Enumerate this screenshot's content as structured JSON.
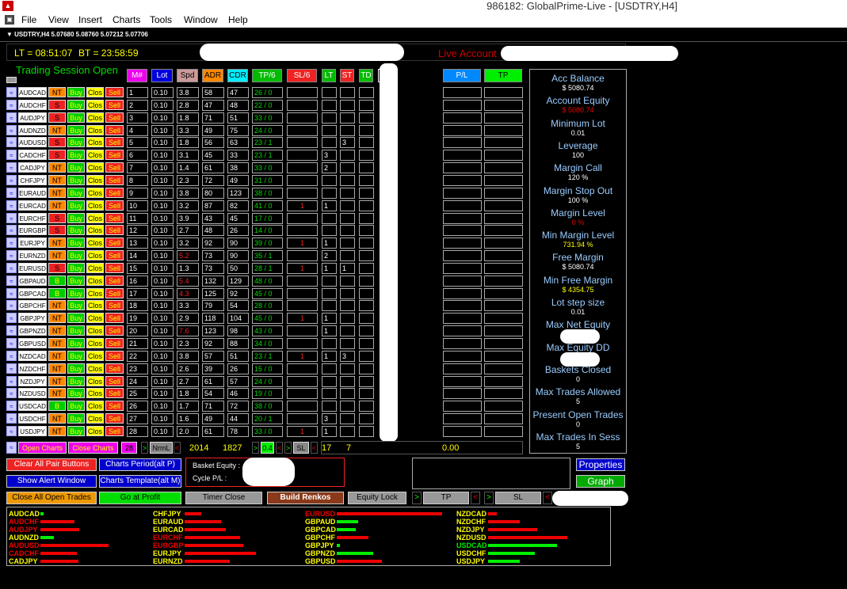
{
  "window": {
    "title": "986182: GlobalPrime-Live - [USDTRY,H4]"
  },
  "menu": [
    "File",
    "View",
    "Insert",
    "Charts",
    "Tools",
    "Window",
    "Help"
  ],
  "chart": {
    "symbol_line": "USDTRY,H4  5.07680 5.08760 5.07212 5.07706"
  },
  "header": {
    "lt": "LT = 08:51:07",
    "bt": "BT = 23:58:59",
    "live": "Live Account"
  },
  "session": "Trading Session Open",
  "columns": {
    "num": "M#",
    "lot": "Lot",
    "spd": "Spd",
    "adr": "ADR",
    "cdr": "CDR",
    "tp": "TP/6",
    "sl": "SL/6",
    "lt": "LT",
    "st": "ST",
    "td": "TD",
    "pl": "P/L",
    "tpr": "TP"
  },
  "row_buttons": {
    "buy": "Buy",
    "close": "Clos",
    "sell": "Sell"
  },
  "rows": [
    {
      "pair": "AUDCAD",
      "mode": "NT",
      "n": "1",
      "lot": "0.10",
      "spd": "3.8",
      "adr": "58",
      "cdr": "47",
      "tp": "26 / 0",
      "sl": "",
      "lt": "",
      "st": "",
      "spd_red": false
    },
    {
      "pair": "AUDCHF",
      "mode": "S",
      "n": "2",
      "lot": "0.10",
      "spd": "2.8",
      "adr": "47",
      "cdr": "48",
      "tp": "22 / 0",
      "sl": "",
      "lt": "",
      "st": "",
      "spd_red": false
    },
    {
      "pair": "AUDJPY",
      "mode": "S",
      "n": "3",
      "lot": "0.10",
      "spd": "1.8",
      "adr": "71",
      "cdr": "51",
      "tp": "33 / 0",
      "sl": "",
      "lt": "",
      "st": "",
      "spd_red": false
    },
    {
      "pair": "AUDNZD",
      "mode": "NT",
      "n": "4",
      "lot": "0.10",
      "spd": "3.3",
      "adr": "49",
      "cdr": "75",
      "tp": "24 / 0",
      "sl": "",
      "lt": "",
      "st": "",
      "spd_red": false
    },
    {
      "pair": "AUDUSD",
      "mode": "S",
      "n": "5",
      "lot": "0.10",
      "spd": "1.8",
      "adr": "56",
      "cdr": "63",
      "tp": "23 / 1",
      "sl": "",
      "lt": "",
      "st": "3",
      "spd_red": false
    },
    {
      "pair": "CADCHF",
      "mode": "S",
      "n": "6",
      "lot": "0.10",
      "spd": "3.1",
      "adr": "45",
      "cdr": "33",
      "tp": "23 / 1",
      "sl": "",
      "lt": "3",
      "st": "",
      "spd_red": false
    },
    {
      "pair": "CADJPY",
      "mode": "NT",
      "n": "7",
      "lot": "0.10",
      "spd": "1.4",
      "adr": "61",
      "cdr": "38",
      "tp": "33 / 0",
      "sl": "",
      "lt": "2",
      "st": "",
      "spd_red": false
    },
    {
      "pair": "CHFJPY",
      "mode": "NT",
      "n": "8",
      "lot": "0.10",
      "spd": "2.3",
      "adr": "72",
      "cdr": "49",
      "tp": "31 / 0",
      "sl": "",
      "lt": "",
      "st": "",
      "spd_red": false
    },
    {
      "pair": "EURAUD",
      "mode": "NT",
      "n": "9",
      "lot": "0.10",
      "spd": "3.8",
      "adr": "80",
      "cdr": "123",
      "tp": "38 / 0",
      "sl": "",
      "lt": "",
      "st": "",
      "spd_red": false
    },
    {
      "pair": "EURCAD",
      "mode": "NT",
      "n": "10",
      "lot": "0.10",
      "spd": "3.2",
      "adr": "87",
      "cdr": "82",
      "tp": "41 / 0",
      "sl": "1",
      "lt": "1",
      "st": "",
      "spd_red": false
    },
    {
      "pair": "EURCHF",
      "mode": "S",
      "n": "11",
      "lot": "0.10",
      "spd": "3.9",
      "adr": "43",
      "cdr": "45",
      "tp": "17 / 0",
      "sl": "",
      "lt": "",
      "st": "",
      "spd_red": false
    },
    {
      "pair": "EURGBP",
      "mode": "S",
      "n": "12",
      "lot": "0.10",
      "spd": "2.7",
      "adr": "48",
      "cdr": "26",
      "tp": "14 / 0",
      "sl": "",
      "lt": "",
      "st": "",
      "spd_red": false
    },
    {
      "pair": "EURJPY",
      "mode": "NT",
      "n": "13",
      "lot": "0.10",
      "spd": "3.2",
      "adr": "92",
      "cdr": "90",
      "tp": "39 / 0",
      "sl": "1",
      "lt": "1",
      "st": "",
      "spd_red": false
    },
    {
      "pair": "EURNZD",
      "mode": "NT",
      "n": "14",
      "lot": "0.10",
      "spd": "5.2",
      "adr": "73",
      "cdr": "90",
      "tp": "35 / 1",
      "sl": "",
      "lt": "2",
      "st": "",
      "spd_red": true
    },
    {
      "pair": "EURUSD",
      "mode": "S",
      "n": "15",
      "lot": "0.10",
      "spd": "1.3",
      "adr": "73",
      "cdr": "50",
      "tp": "28 / 1",
      "sl": "1",
      "lt": "1",
      "st": "1",
      "spd_red": false
    },
    {
      "pair": "GBPAUD",
      "mode": "B",
      "n": "16",
      "lot": "0.10",
      "spd": "5.4",
      "adr": "132",
      "cdr": "129",
      "tp": "48 / 0",
      "sl": "",
      "lt": "",
      "st": "",
      "spd_red": true
    },
    {
      "pair": "GBPCAD",
      "mode": "B",
      "n": "17",
      "lot": "0.10",
      "spd": "4.3",
      "adr": "125",
      "cdr": "92",
      "tp": "45 / 0",
      "sl": "",
      "lt": "",
      "st": "",
      "spd_red": true
    },
    {
      "pair": "GBPCHF",
      "mode": "NT",
      "n": "18",
      "lot": "0.10",
      "spd": "3.3",
      "adr": "79",
      "cdr": "54",
      "tp": "28 / 0",
      "sl": "",
      "lt": "",
      "st": "",
      "spd_red": false
    },
    {
      "pair": "GBPJPY",
      "mode": "NT",
      "n": "19",
      "lot": "0.10",
      "spd": "2.9",
      "adr": "118",
      "cdr": "104",
      "tp": "45 / 0",
      "sl": "1",
      "lt": "1",
      "st": "",
      "spd_red": false
    },
    {
      "pair": "GBPNZD",
      "mode": "NT",
      "n": "20",
      "lot": "0.10",
      "spd": "7.6",
      "adr": "123",
      "cdr": "98",
      "tp": "43 / 0",
      "sl": "",
      "lt": "1",
      "st": "",
      "spd_red": true
    },
    {
      "pair": "GBPUSD",
      "mode": "NT",
      "n": "21",
      "lot": "0.10",
      "spd": "2.3",
      "adr": "92",
      "cdr": "88",
      "tp": "34 / 0",
      "sl": "",
      "lt": "",
      "st": "",
      "spd_red": false
    },
    {
      "pair": "NZDCAD",
      "mode": "NT",
      "n": "22",
      "lot": "0.10",
      "spd": "3.8",
      "adr": "57",
      "cdr": "51",
      "tp": "23 / 1",
      "sl": "1",
      "lt": "1",
      "st": "3",
      "spd_red": false
    },
    {
      "pair": "NZDCHF",
      "mode": "NT",
      "n": "23",
      "lot": "0.10",
      "spd": "2.6",
      "adr": "39",
      "cdr": "26",
      "tp": "15 / 0",
      "sl": "",
      "lt": "",
      "st": "",
      "spd_red": false
    },
    {
      "pair": "NZDJPY",
      "mode": "NT",
      "n": "24",
      "lot": "0.10",
      "spd": "2.7",
      "adr": "61",
      "cdr": "57",
      "tp": "24 / 0",
      "sl": "",
      "lt": "",
      "st": "",
      "spd_red": false
    },
    {
      "pair": "NZDUSD",
      "mode": "NT",
      "n": "25",
      "lot": "0.10",
      "spd": "1.8",
      "adr": "54",
      "cdr": "46",
      "tp": "19 / 0",
      "sl": "",
      "lt": "",
      "st": "",
      "spd_red": false
    },
    {
      "pair": "USDCAD",
      "mode": "B",
      "n": "26",
      "lot": "0.10",
      "spd": "1.7",
      "adr": "71",
      "cdr": "72",
      "tp": "38 / 0",
      "sl": "",
      "lt": "",
      "st": "",
      "spd_red": false
    },
    {
      "pair": "USDCHF",
      "mode": "NT",
      "n": "27",
      "lot": "0.10",
      "spd": "1.6",
      "adr": "49",
      "cdr": "44",
      "tp": "20 / 1",
      "sl": "",
      "lt": "3",
      "st": "",
      "spd_red": false
    },
    {
      "pair": "USDJPY",
      "mode": "NT",
      "n": "28",
      "lot": "0.10",
      "spd": "2.0",
      "adr": "61",
      "cdr": "78",
      "tp": "33 / 0",
      "sl": "1",
      "lt": "1",
      "st": "",
      "spd_red": false
    }
  ],
  "footer_row": {
    "open_charts": "Open Charts",
    "close_charts": "Close Charts",
    "count": "28",
    "nrml": "NrmL",
    "v1": "2014",
    "v2": "1827",
    "step": "0.4",
    "sl": "SL",
    "v3": "17",
    "v4": "7",
    "pl": "0.00"
  },
  "right_panel": [
    {
      "label": "Acc Balance",
      "value": "$ 5080.74",
      "color": "#ffffff"
    },
    {
      "label": "Account Equity",
      "value": "$ 5080.74",
      "color": "#ee0000"
    },
    {
      "label": "Minimum Lot",
      "value": "0.01",
      "color": "#ffffff"
    },
    {
      "label": "Leverage",
      "value": "100",
      "color": "#ffffff"
    },
    {
      "label": "Margin Call",
      "value": "120 %",
      "color": "#ffffff"
    },
    {
      "label": "Margin Stop Out",
      "value": "100 %",
      "color": "#ffffff"
    },
    {
      "label": "Margin Level",
      "value": "0 %",
      "color": "#ee0000"
    },
    {
      "label": "Min Margin Level",
      "value": "731.94 %",
      "color": "#ffff00"
    },
    {
      "label": "Free Margin",
      "value": "$ 5080.74",
      "color": "#ffffff"
    },
    {
      "label": "Min Free Margin",
      "value": "$ 4354.75",
      "color": "#ffff00"
    },
    {
      "label": "Lot step size",
      "value": "0.01",
      "color": "#ffffff"
    },
    {
      "label": "Max Net Equity",
      "value": "",
      "color": "#ffffff"
    },
    {
      "label": "Max Equity DD",
      "value": "",
      "color": "#ffffff"
    },
    {
      "label": "Baskets Closed",
      "value": "0",
      "color": "#ffffff"
    },
    {
      "label": "Max Trades Allowed",
      "value": "5",
      "color": "#ffffff"
    },
    {
      "label": "Present Open Trades",
      "value": "0",
      "color": "#ffffff"
    },
    {
      "label": "Max Trades In Sess",
      "value": "5",
      "color": "#ffffff"
    }
  ],
  "bottom_buttons": {
    "clear_all": "Clear All Pair Buttons",
    "charts_period": "Charts Period(alt P)",
    "show_alert": "Show Alert Window",
    "charts_template": "Charts Template(alt M)",
    "close_all": "Close All Open Trades",
    "go_profit": "Go at Profit",
    "timer_close": "Timer Close",
    "build_renkos": "Build Renkos",
    "equity_lock": "Equity Lock",
    "tp": "TP",
    "sl": "SL",
    "properties": "Properties",
    "graph": "Graph"
  },
  "basket": {
    "equity": "Basket Equity :",
    "cycle": "Cycle P/L :"
  },
  "strength": [
    {
      "name": "AUDCAD",
      "color": "#ffff00",
      "bar": "#00ee00",
      "len": 4
    },
    {
      "name": "AUDCHF",
      "color": "#ee0000",
      "bar": "#ee0000",
      "len": 45
    },
    {
      "name": "AUDJPY",
      "color": "#ee0000",
      "bar": "#ee0000",
      "len": 52
    },
    {
      "name": "AUDNZD",
      "color": "#ffff00",
      "bar": "#00ee00",
      "len": 18
    },
    {
      "name": "AUDUSD",
      "color": "#ee0000",
      "bar": "#ee0000",
      "len": 90
    },
    {
      "name": "CADCHF",
      "color": "#ee0000",
      "bar": "#ee0000",
      "len": 48
    },
    {
      "name": "CADJPY",
      "color": "#ffff00",
      "bar": "#ee0000",
      "len": 50
    },
    {
      "name": "CHFJPY",
      "color": "#ffff00",
      "bar": "#ee0000",
      "len": 22
    },
    {
      "name": "EURAUD",
      "color": "#ffff00",
      "bar": "#ee0000",
      "len": 48
    },
    {
      "name": "EURCAD",
      "color": "#ffff00",
      "bar": "#ee0000",
      "len": 55
    },
    {
      "name": "EURCHF",
      "color": "#ee0000",
      "bar": "#ee0000",
      "len": 74
    },
    {
      "name": "EURGBP",
      "color": "#ee0000",
      "bar": "#ee0000",
      "len": 78
    },
    {
      "name": "EURJPY",
      "color": "#ffff00",
      "bar": "#ee0000",
      "len": 95
    },
    {
      "name": "EURNZD",
      "color": "#ffff00",
      "bar": "#ee0000",
      "len": 60
    },
    {
      "name": "EURUSD",
      "color": "#ee0000",
      "bar": "#ee0000",
      "len": 140
    },
    {
      "name": "GBPAUD",
      "color": "#ffff00",
      "bar": "#00ee00",
      "len": 28
    },
    {
      "name": "GBPCAD",
      "color": "#ffff00",
      "bar": "#00ee00",
      "len": 25
    },
    {
      "name": "GBPCHF",
      "color": "#ffff00",
      "bar": "#ee0000",
      "len": 42
    },
    {
      "name": "GBPJPY",
      "color": "#ffff00",
      "bar": "#00ee00",
      "len": 4
    },
    {
      "name": "GBPNZD",
      "color": "#ffff00",
      "bar": "#00ee00",
      "len": 48
    },
    {
      "name": "GBPUSD",
      "color": "#ffff00",
      "bar": "#ee0000",
      "len": 60
    },
    {
      "name": "NZDCAD",
      "color": "#ffff00",
      "bar": "#ee0000",
      "len": 12
    },
    {
      "name": "NZDCHF",
      "color": "#ffff00",
      "bar": "#ee0000",
      "len": 42
    },
    {
      "name": "NZDJPY",
      "color": "#ffff00",
      "bar": "#ee0000",
      "len": 65
    },
    {
      "name": "NZDUSD",
      "color": "#ffff00",
      "bar": "#ee0000",
      "len": 105
    },
    {
      "name": "USDCAD",
      "color": "#00ee00",
      "bar": "#00ee00",
      "len": 92
    },
    {
      "name": "USDCHF",
      "color": "#ffff00",
      "bar": "#00ee00",
      "len": 62
    },
    {
      "name": "USDJPY",
      "color": "#ffff00",
      "bar": "#00ee00",
      "len": 42
    }
  ]
}
